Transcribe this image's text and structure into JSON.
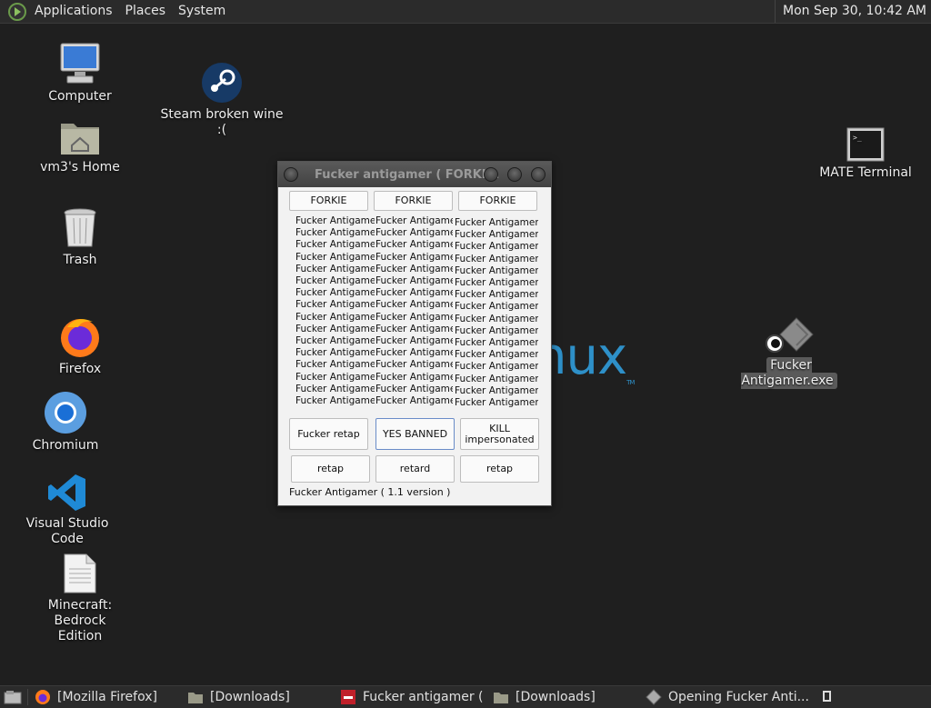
{
  "top_panel": {
    "menus": [
      "Applications",
      "Places",
      "System"
    ],
    "clock": "Mon Sep 30, 10:42 AM"
  },
  "desktop": {
    "icons": {
      "computer": "Computer",
      "home": "vm3's Home",
      "trash": "Trash",
      "firefox": "Firefox",
      "chromium": "Chromium",
      "vscode": "Visual Studio Code",
      "minecraft": "Minecraft: Bedrock\nEdition",
      "steam": "Steam broken wine :(",
      "terminal": "MATE Terminal",
      "exe": "Fucker Antigamer.exe"
    },
    "watermark": "nux",
    "watermark_tm": "TM"
  },
  "window": {
    "title": "Fucker antigamer ( FORKI...",
    "top_buttons": [
      "FORKIE",
      "FORKIE",
      "FORKIE"
    ],
    "label_text": "Fucker Antigamer",
    "label_rows": 16,
    "mid_buttons": [
      "Fucker retap",
      "YES BANNED",
      "KILL impersonated"
    ],
    "bottom_buttons": [
      "retap",
      "retard",
      "retap"
    ],
    "footer": "Fucker Antigamer ( 1.1 version )"
  },
  "taskbar": {
    "tasks": [
      "[Mozilla Firefox]",
      "[Downloads]",
      "Fucker antigamer ( ...",
      "[Downloads]",
      "Opening Fucker Anti..."
    ]
  },
  "colors": {
    "desktop_bg": "#1f1f1f",
    "panel_bg": "#2b2b2b",
    "accent_blue": "#2e90c8"
  }
}
